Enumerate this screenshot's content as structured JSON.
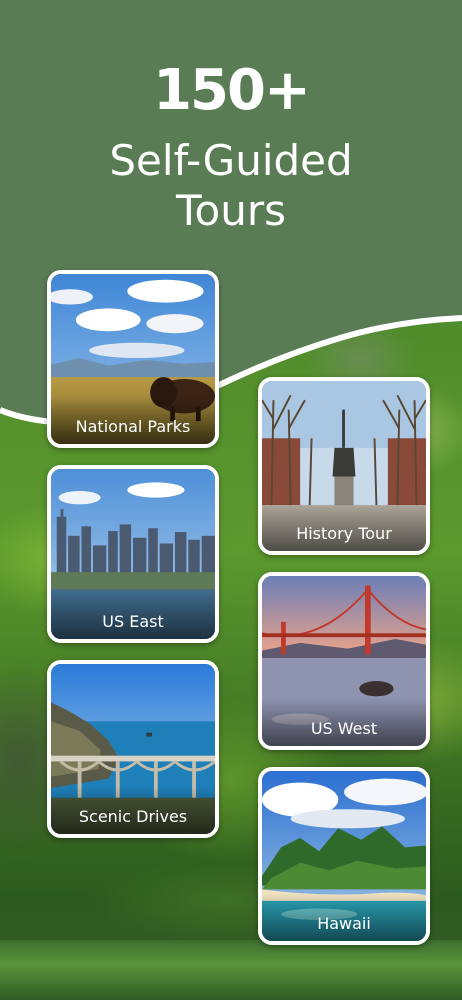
{
  "hero": {
    "count": "150+",
    "subtitle_line1": "Self-Guided",
    "subtitle_line2": "Tours"
  },
  "colors": {
    "header_green": "#5a7c55",
    "card_border": "#ffffff",
    "label_text": "#ffffff"
  },
  "cards": [
    {
      "label": "National Parks",
      "image": "bison-prairie-image"
    },
    {
      "label": "History Tour",
      "image": "statue-park-image"
    },
    {
      "label": "US East",
      "image": "city-skyline-image"
    },
    {
      "label": "US West",
      "image": "golden-gate-bridge-image"
    },
    {
      "label": "Scenic Drives",
      "image": "coastal-bridge-image"
    },
    {
      "label": "Hawaii",
      "image": "island-mountains-image"
    }
  ]
}
